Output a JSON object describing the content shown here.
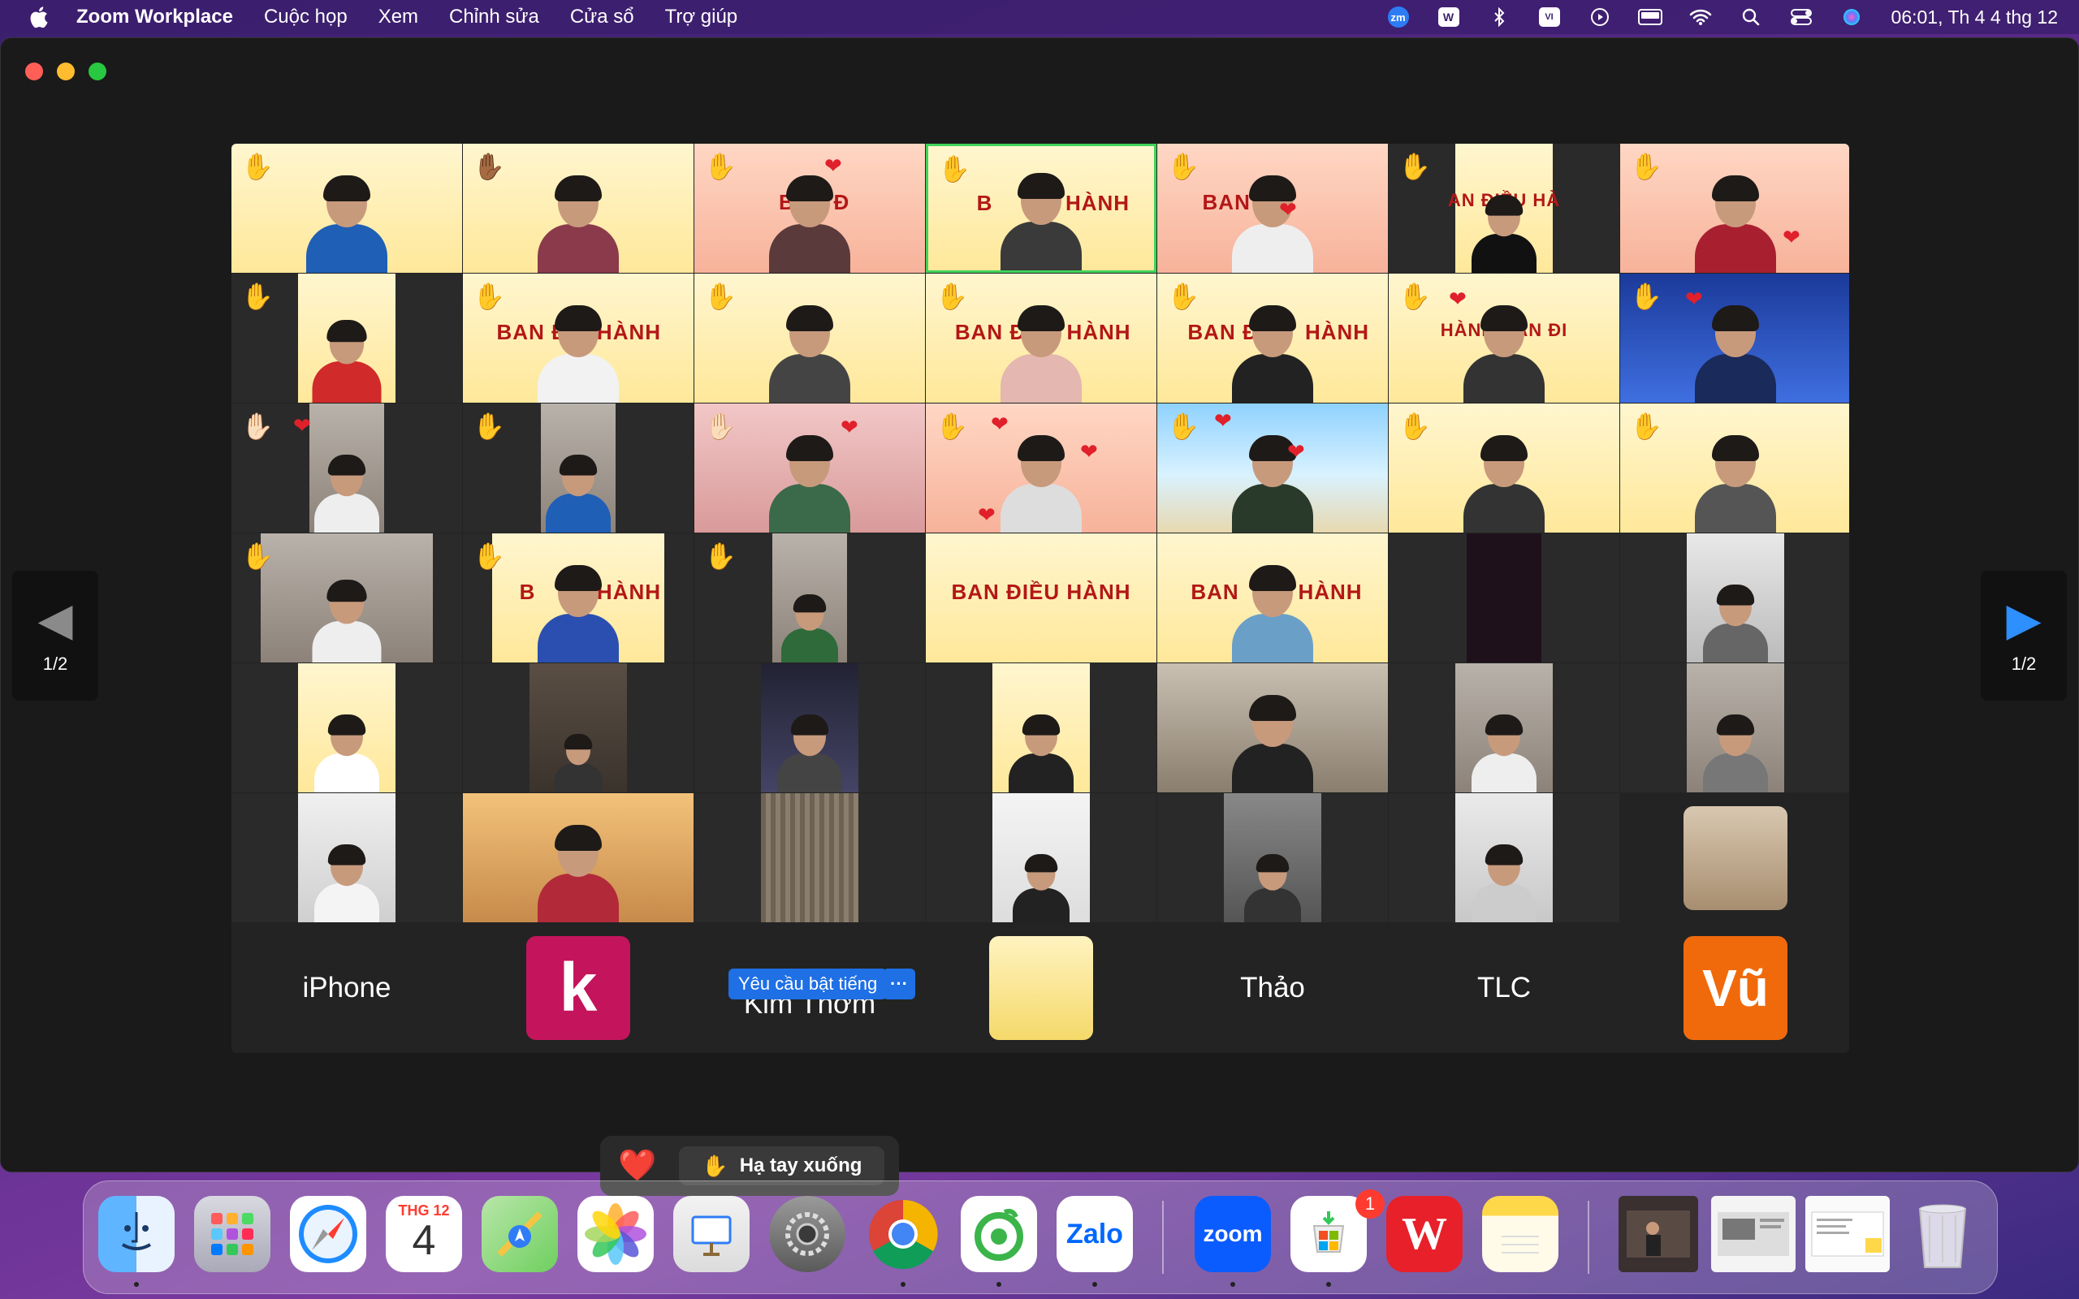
{
  "menubar": {
    "app_name": "Zoom Workplace",
    "items": [
      "Cuộc họp",
      "Xem",
      "Chỉnh sửa",
      "Cửa sổ",
      "Trợ giúp"
    ],
    "status_icons": [
      "zoom-status-icon",
      "wps-status-icon",
      "bluetooth-icon",
      "vietnamese-input-icon",
      "screen-record-icon",
      "battery-icon",
      "wifi-icon",
      "spotlight-search-icon",
      "control-center-icon",
      "siri-icon"
    ],
    "zoom_status_text": "zm",
    "wps_status_text": "W",
    "input_status_text": "VI",
    "clock": "06:01, Th 4 4 thg 12"
  },
  "meeting": {
    "banner_text_full": "BAN ĐIỀU HÀNH",
    "banner_text_partial_1": "BAN Đ",
    "banner_text_partial_2": "HÀNH",
    "banner_text_partial_3": "BAN ĐI",
    "banner_text_partial_4": "BAN",
    "banner_text_partial_5": "AN ĐIỀU HÀ",
    "banner_text_partial_6": "HÀNH BAN ĐI",
    "banner_text_partial_7": "B",
    "labels": {
      "iphone": "iPhone",
      "kim_thom": "Kim Thơm",
      "thao": "Thảo",
      "tlc": "TLC"
    },
    "avatars": {
      "k": "k",
      "vu": "Vũ"
    },
    "unmute_request": "Yêu cầu bật tiếng",
    "more_label": "···",
    "page_indicator_left": "1/2",
    "page_indicator_right": "1/2"
  },
  "reactions": {
    "heart": "❤️",
    "lower_hand_label": "Hạ tay xuống",
    "lower_hand_icon": "✋"
  },
  "dock": {
    "calendar_month": "THG 12",
    "calendar_day": "4",
    "zoom_text": "zoom",
    "zalo_text": "Zalo",
    "store_badge": "1",
    "wps_text": "W",
    "apps": [
      "finder-icon",
      "launchpad-icon",
      "safari-icon",
      "calendar-icon",
      "maps-icon",
      "photos-icon",
      "keynote-icon",
      "system-settings-icon",
      "chrome-icon",
      "coccoc-icon",
      "zalo-icon",
      "zoom-icon",
      "microsoft-store-icon",
      "wps-office-icon",
      "notes-icon",
      "window-preview-1",
      "window-preview-2",
      "window-preview-3",
      "trash-icon"
    ]
  },
  "colors": {
    "active_speaker_border": "#3fd35a",
    "unmute_blue": "#1f6fe5",
    "avatar_k": "#c4145c",
    "avatar_vu": "#f06a0c"
  }
}
